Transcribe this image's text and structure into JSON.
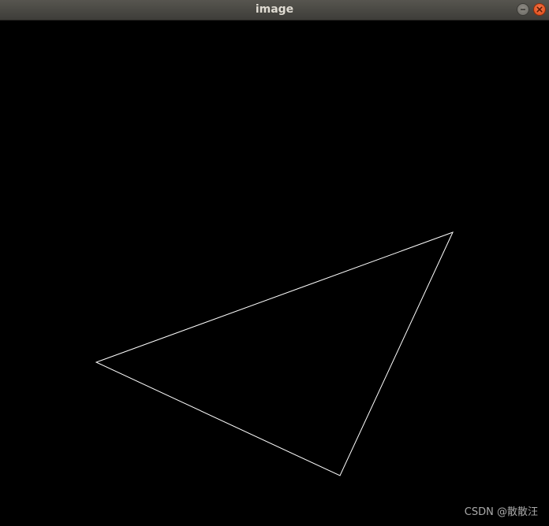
{
  "window": {
    "title": "image"
  },
  "titlebar_buttons": {
    "minimize_icon": "minimize-icon",
    "close_icon": "close-icon",
    "close_color": "#dd4814",
    "minimize_color": "#7a7873"
  },
  "canvas": {
    "background": "#000000",
    "shape": "triangle",
    "stroke_color": "#ffffff"
  },
  "watermark": {
    "text": "CSDN @散散汪"
  }
}
